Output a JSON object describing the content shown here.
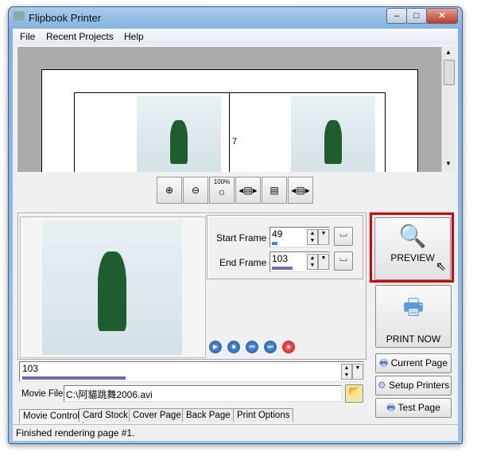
{
  "window": {
    "title": "Flipbook Printer",
    "controls": [
      "minimize",
      "maximize",
      "close"
    ]
  },
  "menu": [
    "File",
    "Recent Projects",
    "Help"
  ],
  "preview": {
    "page_number": "7"
  },
  "toolbar": [
    {
      "icon": "zoom-in-icon",
      "label": ""
    },
    {
      "icon": "zoom-out-icon",
      "label": ""
    },
    {
      "icon": "zoom-100-icon",
      "label": "100%"
    },
    {
      "icon": "fit-width-icon",
      "label": ""
    },
    {
      "icon": "fit-height-icon",
      "label": ""
    },
    {
      "icon": "fit-page-icon",
      "label": ""
    }
  ],
  "frames": {
    "start_label": "Start Frame #",
    "start_value": "49",
    "start_progress": 0.1,
    "end_label": "End Frame #",
    "end_value": "103",
    "end_progress": 0.35
  },
  "playback": {
    "frame_value": "103",
    "progress": 0.3,
    "buttons": [
      "play",
      "stop",
      "previous",
      "next",
      "record"
    ]
  },
  "movie_file": {
    "label": "Movie File:",
    "value": "C:\\阿貓跳舞2006.avi"
  },
  "tabs": [
    "Movie Control",
    "Card Stock",
    "Cover Page",
    "Back Page",
    "Print Options"
  ],
  "active_tab": "Movie Control",
  "buttons": {
    "preview": "PREVIEW",
    "print_now": "PRINT NOW",
    "current_page": "Current Page",
    "setup_printers": "Setup Printers",
    "test_page": "Test Page"
  },
  "status": "Finished rendering page #1.",
  "colors": {
    "highlight": "#e00000",
    "progress": "#7068c0",
    "start_progress": "#4a80dc"
  }
}
